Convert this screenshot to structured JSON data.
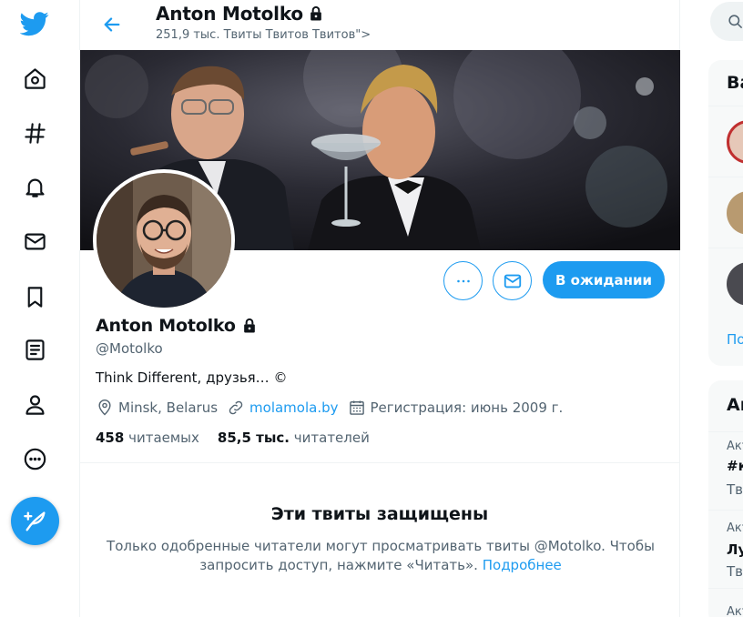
{
  "header": {
    "title": "Anton Motolko",
    "subtitle": "251,9 тыс. Твиты Твитов Твитов\">"
  },
  "profile": {
    "name": "Anton Motolko",
    "handle": "@Motolko",
    "bio": "Think Different, друзья… ©",
    "location": "Minsk, Belarus",
    "website": "molamola.by",
    "joined": "Регистрация: июнь 2009 г.",
    "following_count": "458",
    "following_label": "читаемых",
    "followers_count": "85,5 тыс.",
    "followers_label": "читателей"
  },
  "actions": {
    "pending_label": "В ожидании"
  },
  "protected": {
    "title": "Эти твиты защищены",
    "text": "Только одобренные читатели могут просматривать твиты @Motolko. Чтобы запросить доступ, нажмите «Читать».",
    "learn_more": "Подробнее"
  },
  "right": {
    "panel1_title": "Ва",
    "panel1_more": "По",
    "panel2_title": "Ак",
    "trends": [
      {
        "small": "Акт",
        "big": "#к",
        "small2": "Тв"
      },
      {
        "small": "Акт",
        "big": "Лу",
        "small2": "Тв"
      },
      {
        "small": "Акт"
      }
    ]
  },
  "colors": {
    "accent": "#1d9bf0",
    "text_secondary": "#536471"
  },
  "icons": [
    "twitter-logo-icon",
    "home-icon",
    "hashtag-icon",
    "bell-icon",
    "mail-icon",
    "bookmark-icon",
    "list-icon",
    "profile-icon",
    "more-icon",
    "compose-icon",
    "back-arrow-icon",
    "lock-icon",
    "location-icon",
    "link-icon",
    "calendar-icon",
    "search-icon"
  ]
}
